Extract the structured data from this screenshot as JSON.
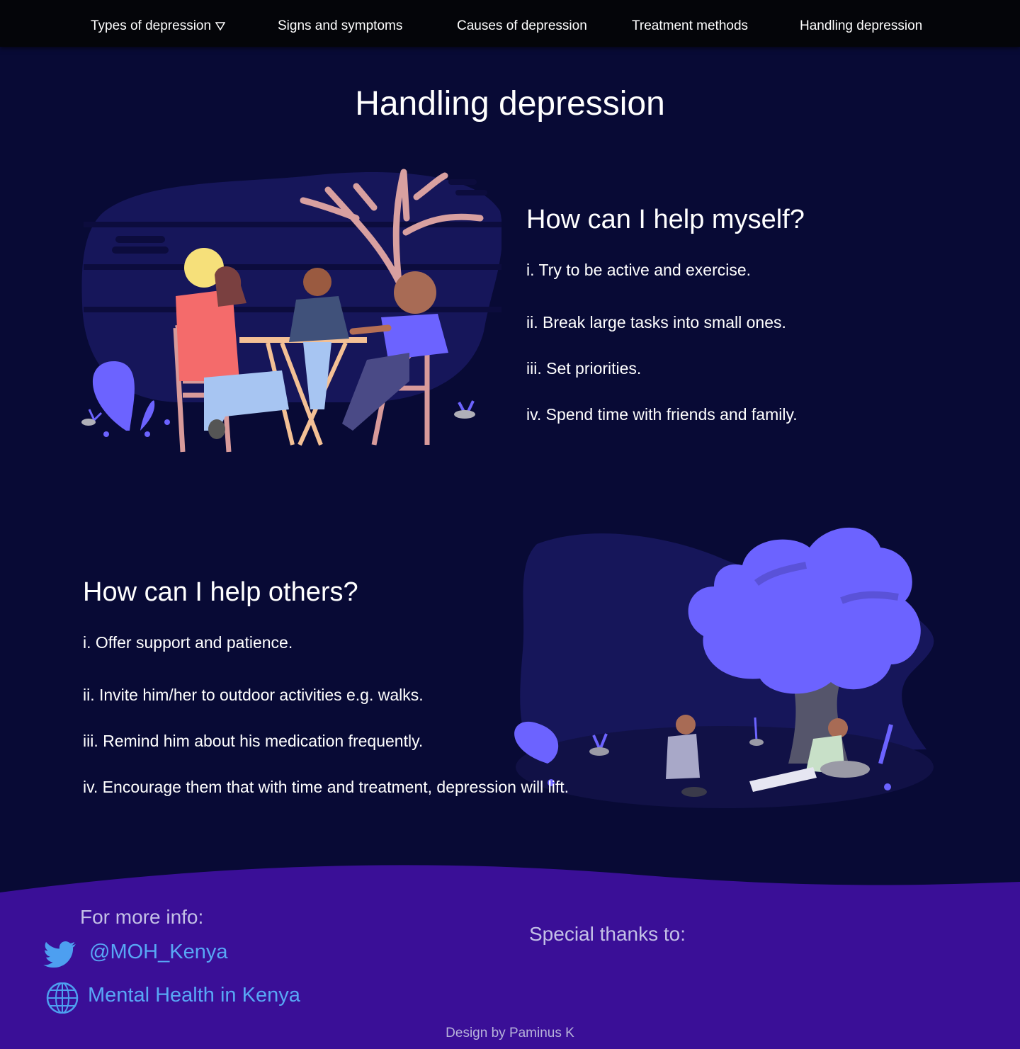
{
  "nav": {
    "items": [
      {
        "label": "Types of depression",
        "has_dropdown": true
      },
      {
        "label": "Signs and symptoms"
      },
      {
        "label": "Causes of depression"
      },
      {
        "label": "Treatment methods"
      },
      {
        "label": "Handling depression"
      }
    ],
    "dropdown_icon": "triangle-down-icon"
  },
  "page": {
    "title": "Handling depression"
  },
  "self_help": {
    "heading": "How can I help myself?",
    "tips": [
      "i. Try to be active and exercise.",
      "ii. Break large tasks into small ones.",
      "iii. Set priorities.",
      "iv. Spend time with friends and family."
    ]
  },
  "help_others": {
    "heading": "How can I help others?",
    "tips": [
      "i. Offer support and patience.",
      "ii. Invite him/her to outdoor activities e.g. walks.",
      "iii. Remind him about his medication frequently.",
      "iv. Encourage them that with time and treatment, depression will lift."
    ]
  },
  "footer": {
    "more_info_label": "For more info:",
    "twitter_handle": "@MOH_Kenya",
    "twitter_icon": "twitter-icon",
    "website_label": "Mental Health in Kenya",
    "website_icon": "globe-icon",
    "thanks_label": "Special thanks to:",
    "credit": "Design by Paminus K"
  },
  "colors": {
    "background": "#080a35",
    "nav_background": "#040509",
    "footer_background": "#3a0f97",
    "link": "#58a7f5",
    "accent_purple": "#6c63ff"
  }
}
